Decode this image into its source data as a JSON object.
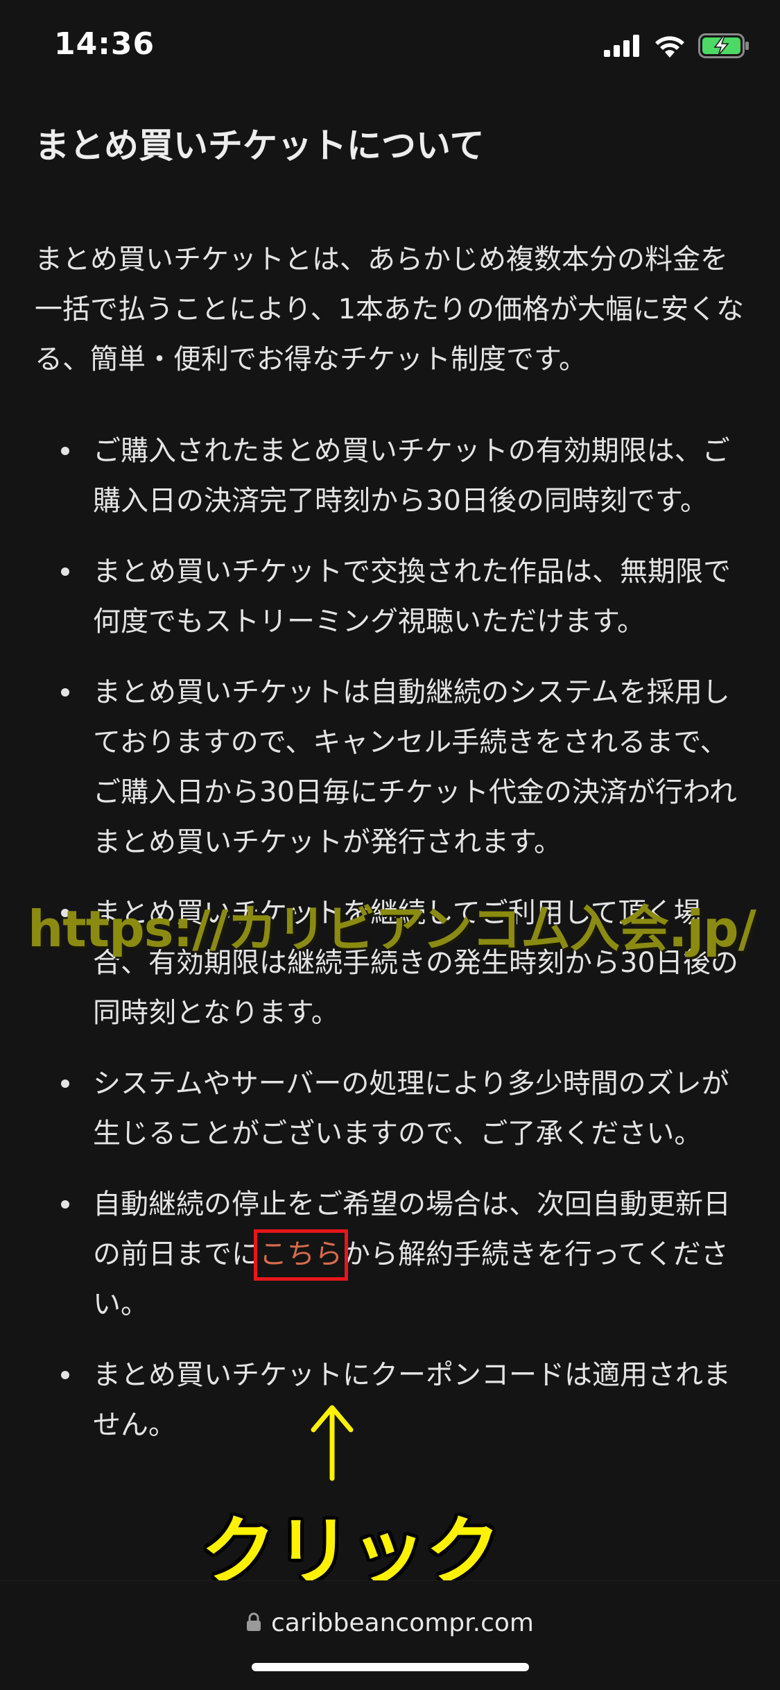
{
  "status_bar": {
    "time": "14:36",
    "icons": [
      "signal-icon",
      "wifi-icon",
      "battery-charging-icon"
    ],
    "battery_color": "#4cd964"
  },
  "page": {
    "title": "まとめ買いチケットについて",
    "intro": "まとめ買いチケットとは、あらかじめ複数本分の料金を一括で払うことにより、1本あたりの価格が大幅に安くなる、簡単・便利でお得なチケット制度です。",
    "bullets": [
      "ご購入されたまとめ買いチケットの有効期限は、ご購入日の決済完了時刻から30日後の同時刻です。",
      "まとめ買いチケットで交換された作品は、無期限で何度でもストリーミング視聴いただけます。",
      "まとめ買いチケットは自動継続のシステムを採用しておりますので、キャンセル手続きをされるまで、ご購入日から30日毎にチケット代金の決済が行われまとめ買いチケットが発行されます。",
      "まとめ買いチケットを継続してご利用して頂く場合、有効期限は継続手続きの発生時刻から30日後の同時刻となります。",
      "システムやサーバーの処理により多少時間のズレが生じることがございますので、ご了承ください。"
    ],
    "cancel_bullet": {
      "before": "自動継続の停止をご希望の場合は、次回自動更新日の前日までに",
      "link": "こちら",
      "after": "から解約手続きを行ってください。"
    },
    "last_bullet": "まとめ買いチケットにクーポンコードは適用されません。",
    "link_color": "#d86b4e"
  },
  "overlay": {
    "watermark": "https://カリビアンコム入会.jp/",
    "click_label": "クリック",
    "highlight_color": "#e8161b",
    "annotation_color": "#fff200"
  },
  "browser": {
    "url": "caribbeancompr.com"
  }
}
